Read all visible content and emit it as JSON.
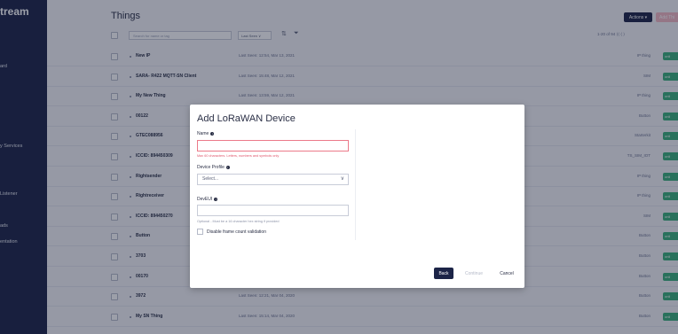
{
  "sidebar": {
    "brand": "tream",
    "items": [
      "ard",
      "y Services",
      "Listener",
      "ads",
      "entation"
    ]
  },
  "header": {
    "title": "Things",
    "actions_label": "Actions ▾",
    "add_label": "Add Thi"
  },
  "toolbar": {
    "search_placeholder": "Search for name or tag",
    "sort_value": "Last Seen ∨",
    "pager_text": "1-20 of 94  ⟨⟨  ⟨  ⟩"
  },
  "rows": [
    {
      "name": "New IP",
      "seen": "Last Seen: 12:54, Mar 13, 2021",
      "type": "IP thing",
      "status": "onli"
    },
    {
      "name": "SARA- R422 MQTT-SN Client",
      "seen": "Last Seen: 15:48, Mar 12, 2021",
      "type": "SIM",
      "status": "onli"
    },
    {
      "name": "My New Thing",
      "seen": "Last Seen: 13:59, Mar 12, 2021",
      "type": "IP thing",
      "status": "onli"
    },
    {
      "name": "00122",
      "seen": "",
      "type": "Button",
      "status": "onli"
    },
    {
      "name": "GTEC088956",
      "seen": "",
      "type": "Starterkit",
      "status": "onli"
    },
    {
      "name": "ICCID: 894450309",
      "seen": "",
      "type": "TS_SIM_IOT",
      "status": "onli"
    },
    {
      "name": "Rightsender",
      "seen": "",
      "type": "IP thing",
      "status": "onli"
    },
    {
      "name": "Rightreceiver",
      "seen": "",
      "type": "IP thing",
      "status": "onli"
    },
    {
      "name": "ICCID: 894450270",
      "seen": "",
      "type": "SIM",
      "status": "onli"
    },
    {
      "name": "Button",
      "seen": "",
      "type": "Button",
      "status": "onli"
    },
    {
      "name": "3703",
      "seen": "",
      "type": "Button",
      "status": "onli"
    },
    {
      "name": "00170",
      "seen": "",
      "type": "Button",
      "status": "onli"
    },
    {
      "name": "3972",
      "seen": "Last Seen: 12:21, Mar 04, 2020",
      "type": "Button",
      "status": "onli"
    },
    {
      "name": "My SN Thing",
      "seen": "Last Seen: 15:14, Mar 04, 2020",
      "type": "Button",
      "status": "onli"
    }
  ],
  "modal": {
    "title": "Add LoRaWAN Device",
    "name_label": "Name",
    "name_value": "",
    "name_hint": "Max 60 characters. Letters, numbers and symbols only",
    "profile_label": "Device Profile",
    "profile_value": "Select...",
    "deveui_label": "DevEUI",
    "deveui_value": "",
    "deveui_hint": "Optional - Must be a 16 character hex string if provided",
    "checkbox_label": "Disable frame count validation",
    "back_label": "Back",
    "continue_label": "Continue",
    "cancel_label": "Cancel"
  },
  "colors": {
    "sidebar": "#1c2447",
    "accent_pink": "#f3b9c3",
    "status_green": "#3ab07a",
    "error": "#e0566c"
  }
}
